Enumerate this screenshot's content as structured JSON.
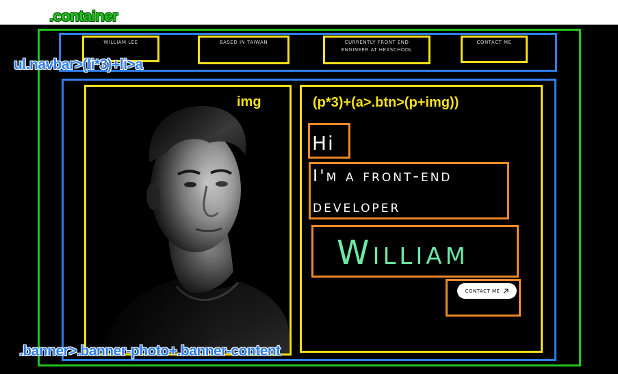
{
  "annotations": {
    "container": ".container",
    "navbar": "ul.navbar>(li*3)+li>a",
    "banner": ".banner>.banner-photo+.banner-content",
    "img": "img",
    "content": "(p*3)+(a>.btn>(p+img))"
  },
  "navbar": {
    "items": [
      {
        "label": "William Lee"
      },
      {
        "label": "Based in Taiwan"
      },
      {
        "label": "Currently front end engineer at hexschool"
      },
      {
        "label": "Contact me"
      }
    ]
  },
  "banner": {
    "greeting": "Hi",
    "role_line1": "I'm a front-end",
    "role_line2": "developer",
    "name": "William",
    "button_label": "Contact me",
    "button_icon": "arrow-up-right-icon"
  },
  "colors": {
    "background": "#000000",
    "container_outline": "#22c51e",
    "block_outline": "#2f7fe9",
    "element_outline": "#f6e11b",
    "text_outline": "#ef8a27",
    "name_color": "#6ee7a5",
    "button_bg": "#ffffff"
  }
}
